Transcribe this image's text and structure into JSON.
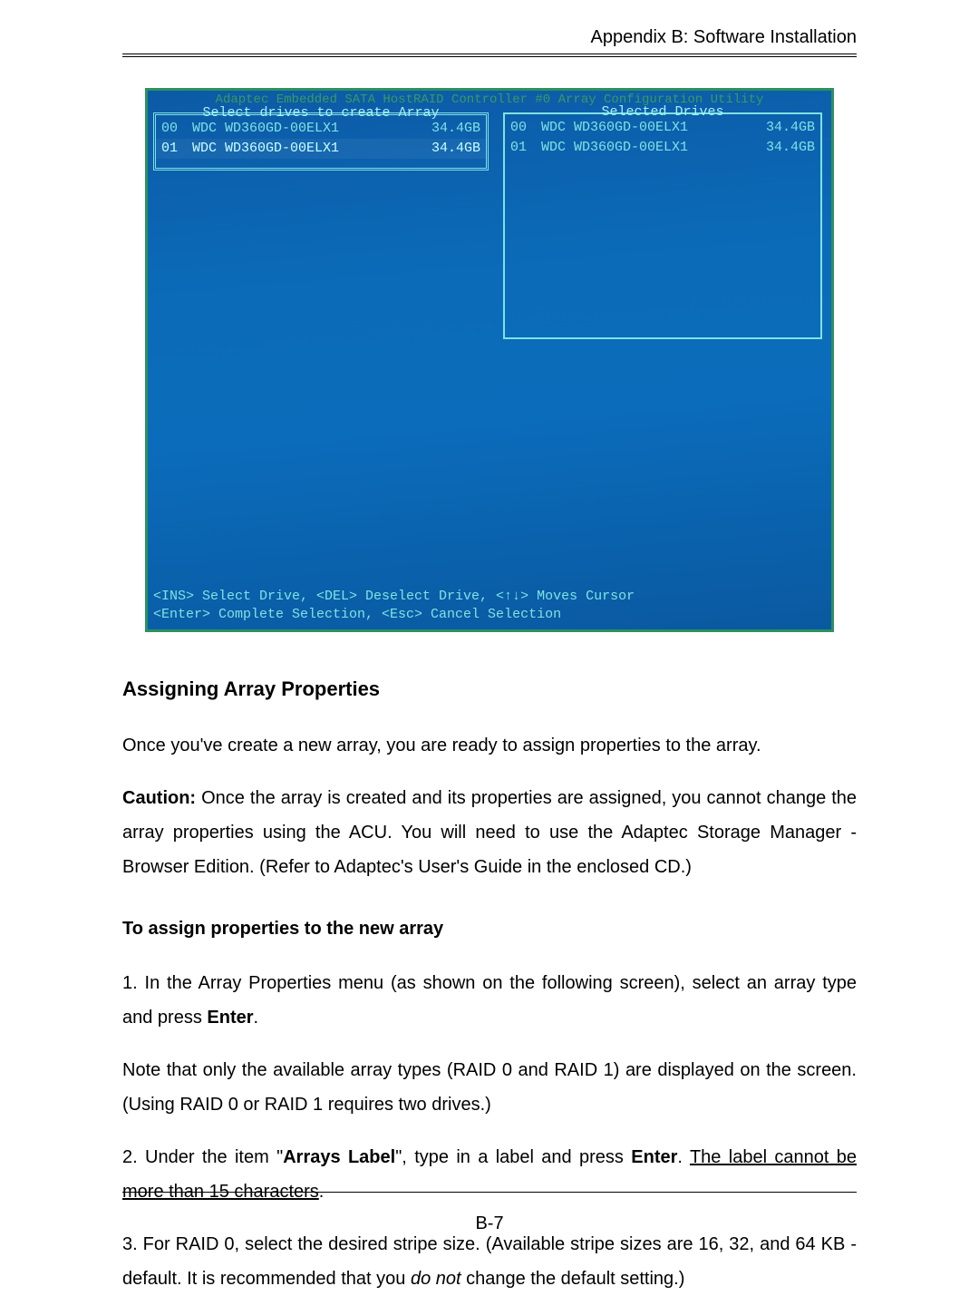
{
  "header": {
    "appendix": "Appendix B: Software Installation"
  },
  "console": {
    "title": "Adaptec Embedded SATA HostRAID Controller #0 Array Configuration Utility",
    "left_panel_title": "Select drives to create Array",
    "right_panel_title": "Selected Drives",
    "left_rows": [
      {
        "id": "00",
        "name": "WDC WD360GD-00ELX1",
        "size": "34.4GB"
      },
      {
        "id": "01",
        "name": "WDC WD360GD-00ELX1",
        "size": "34.4GB"
      }
    ],
    "right_rows": [
      {
        "id": "00",
        "name": "WDC WD360GD-00ELX1",
        "size": "34.4GB"
      },
      {
        "id": "01",
        "name": "WDC WD360GD-00ELX1",
        "size": "34.4GB"
      }
    ],
    "help_line1": "<INS> Select Drive, <DEL> Deselect Drive, <↑↓> Moves Cursor",
    "help_line2": "<Enter> Complete Selection, <Esc> Cancel Selection"
  },
  "section": {
    "heading": "Assigning Array Properties",
    "p1": "Once you've create a new array, you are ready to assign properties to the array.",
    "caution_label": "Caution:",
    "caution_rest": " Once the array is created and its properties are assigned, you cannot change the array properties using the ACU. You will need to  use the Adaptec Storage Manager - Browser Edition.  (Refer to Adaptec's User's Guide in the enclosed CD.)",
    "subheading": "To assign properties to the new array",
    "step1_a": "1. In the Array Properties menu (as shown on the following screen), select an array type and press ",
    "step1_enter": "Enter",
    "step1_b": ".",
    "note": "Note that only the available array types (RAID 0 and RAID 1) are displayed on the screen. (Using RAID 0 or RAID 1 requires two drives.)",
    "step2_a": "2. Under the item \"",
    "step2_label": "Arrays Label",
    "step2_b": "\", type in a label and press ",
    "step2_enter": "Enter",
    "step2_c": ".  ",
    "step2_underlined": "The label cannot be more than 15 characters",
    "step2_d": ".",
    "step3_a": "3. For RAID 0, select the desired stripe size. (Available stripe sizes are 16, 32, and 64 KB - default. It is recommended that you ",
    "step3_italic": "do not",
    "step3_b": " change the default setting.)"
  },
  "page_number": "B-7"
}
